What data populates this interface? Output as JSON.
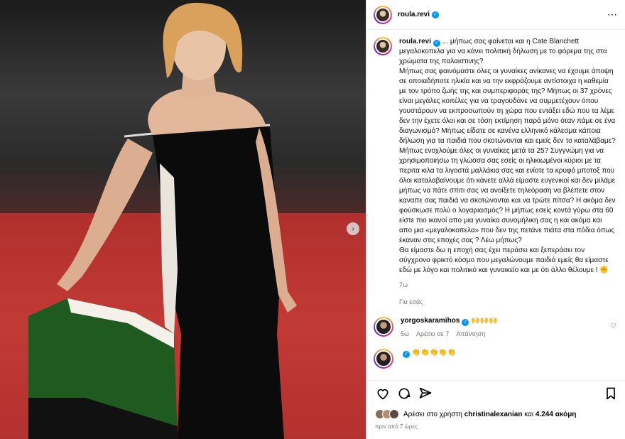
{
  "header": {
    "username": "roula.revi"
  },
  "caption": {
    "username": "roula.revi",
    "text": "... μήπως σας φαίνεται και η Cate Blanchett μεγαλοκοπελα για να κάνει πολιτική δήλωση με το φόρεμα της στα χρώματα της παλαιστινης?\nΜήπως σας φαινόμαστε όλες οι γυναίκες ανίκανες να έχουμε άποψη σε οποιαδήποτε ηλικία και να την εκφράζουμε αντίστοιχα η καθεμία με τον τρόπο ζωής της και συμπεριφοράς της? Μήπως οι 37 χρόνες είναι μεγάλες κοπέλες για να τραγουδάνε να συμμετέχουν όπου γουστάρουν να εκπροσωπούν τη χώρα που εντάξει εδώ που τα λέμε δεν την έχετε όλοι και σε τόση εκτίμηση παρά μόνο όταν πάμε σε ένα διαγωνισμό? Μήπως είδατε σε κανένα ελληνικό κάλεσμα κάποια δήλωση για τα παιδιά που σκοτώνονται και εμείς δεν το καταλάβαμε? Μήπως ενοχλούμε όλες οι γυναίκες μετά τα 25? Συγγνώμη για να χρησιμοποιήσω τη γλώσσα σας εσείς οι ηλικιωμένοι κύριοι με τα περιτα κιλα τα λιγοστά μαλλάκια σας και ενίοτε τα κρυφό μποτοξ που όλοι καταλαβαίνουμε ότι κάνετε αλλά είμαστε ευγενικοί και δεν μιλάμε μήπως να πάτε σπιτι σας να ανοίξετε τηλεόραση να βλέπετε στον καναπε σας παιδιά να σκοτώνονται και να τρώτε πίτσα? Η ακόμα δεν φούσκωσε πολύ ο λογαριασμός? Η μήπως εσείς κοντά γύρω στα 60 είστε πιο ικανοί απο μια γυναίκα συνομήλικη σας η και ακόμα και απο μια «μεγαλοκοπελα» που δεν της πετάνε πιάτα στα πόδια όπως έκαναν στις εποχές σας ? Λέω μήπως?\nΘα είμαστε δω η εποχή σας έχει περάσει και ξεπεράσει τον σύγχρονο φρικτό κόσμο που μεγαλώνουμε παιδιά εμείς θα είμαστε εδώ με λόγο και πολιτικό και γυναικείο και με ότι άλλο θέλουμε ! ✊",
    "time": "7ω",
    "translate_label": "Για εσάς"
  },
  "comments": [
    {
      "username": "yorgoskaramihos",
      "text": "🙌🙌🙌",
      "time": "5ω",
      "likes_label": "Αρέσει σε 7",
      "reply_label": "Απάντηση"
    },
    {
      "username": "",
      "text": "👏👏👏👏👏"
    }
  ],
  "likes": {
    "prefix": "Αρέσει στο χρήστη",
    "user": "christinalexanian",
    "joiner": "και",
    "count": "4.244 ακόμη"
  },
  "posted_ago": "πριν από 7 ώρες",
  "colors": {
    "verified": "#0095f6",
    "meta_gray": "#737373",
    "carpet_red": "#c23a36"
  }
}
